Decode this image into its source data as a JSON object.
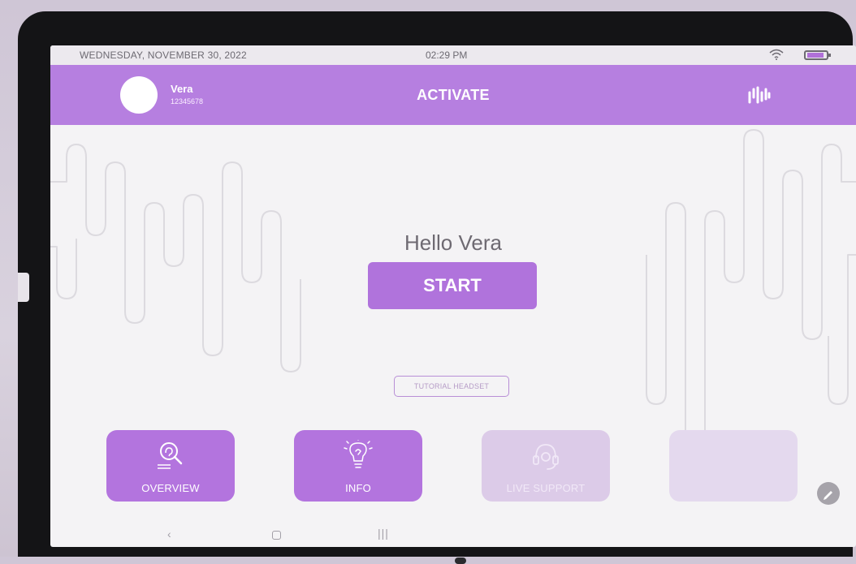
{
  "statusbar": {
    "date": "WEDNESDAY, NOVEMBER 30, 2022",
    "time": "02:29 PM",
    "icons": [
      "wifi-icon",
      "battery-icon"
    ]
  },
  "header": {
    "user_name": "Vera",
    "user_id": "12345678",
    "title": "ACTIVATE",
    "brand_icon": "waveform-logo-icon"
  },
  "main": {
    "greeting": "Hello Vera",
    "start_label": "START",
    "tutorial_label": "TUTORIAL HEADSET"
  },
  "tiles": [
    {
      "label": "OVERVIEW",
      "icon": "search-brain-icon",
      "enabled": true
    },
    {
      "label": "INFO",
      "icon": "lightbulb-icon",
      "enabled": true
    },
    {
      "label": "LIVE SUPPORT",
      "icon": "headset-support-icon",
      "enabled": false
    },
    {
      "label": "",
      "icon": "",
      "enabled": false
    }
  ],
  "navbar": {
    "back": "‹",
    "recent": "|||"
  },
  "colors": {
    "accent": "#b67fe0",
    "accent_dark": "#b073dc",
    "disabled_tile": "#dccbe8",
    "background": "#f4f3f5",
    "text_muted": "#6e6a72"
  }
}
